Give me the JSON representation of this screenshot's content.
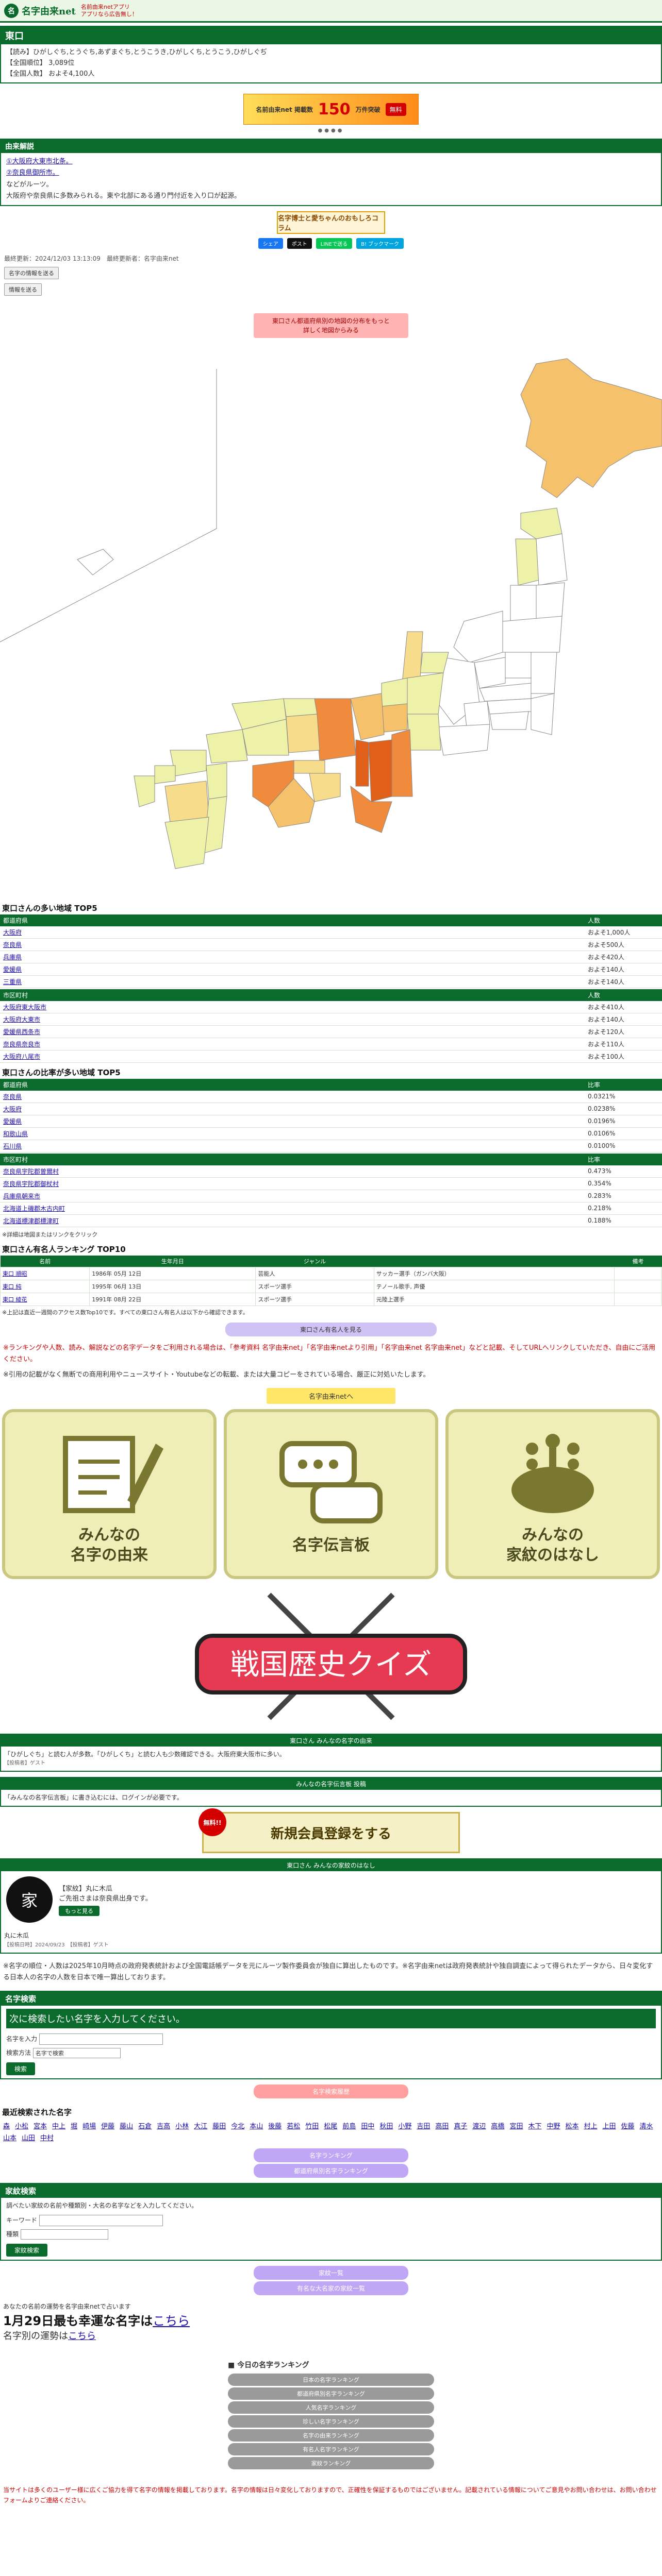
{
  "header": {
    "logo_mark": "名",
    "logo_text": "名字由来net",
    "note1": "名前由来netアプリ",
    "note2": "アプリなら広告無し！"
  },
  "title": {
    "name": "東口",
    "reading": "【読み】ひがしぐち,とうぐち,あずまぐち,とうこうき,ひがしくち,とうこう,ひがしぐぢ",
    "rank": "【全国順位】 3,089位",
    "population": "【全国人数】 およそ4,100人"
  },
  "ad": {
    "left": "名前由来net 掲載数",
    "num": "150",
    "tail": "万件突破",
    "btn": "無料"
  },
  "origin": {
    "heading": "由来解説",
    "lines": [
      "①大阪府大東市北条。",
      "②奈良県御所市。",
      "などがルーツ。",
      "大阪府や奈良県に多数みられる。東や北部にある通り門付近を入り口が起源。"
    ]
  },
  "banner": "名字博士と愛ちゃんのおもしろコラム",
  "share": {
    "fb": "シェア",
    "tw": "ポスト",
    "line": "LINEで送る",
    "hb": "B! ブックマーク"
  },
  "update": "最終更新：2024/12/03 13:13:09　最終更新者：名字由来net",
  "btn_edit": "名字の情報を送る",
  "btn_report": "情報を送る",
  "map_notice": [
    "東口さん都道府県別の地図の分布をもっと",
    "詳しく地図からみる"
  ],
  "top5_count": {
    "heading": "東口さんの多い地域 TOP5",
    "pref_header": [
      "都道府県",
      "人数"
    ],
    "prefs": [
      [
        "大阪府",
        "およそ1,000人"
      ],
      [
        "奈良県",
        "およそ500人"
      ],
      [
        "兵庫県",
        "およそ420人"
      ],
      [
        "愛媛県",
        "およそ140人"
      ],
      [
        "三重県",
        "およそ140人"
      ]
    ],
    "city_header": [
      "市区町村",
      "人数"
    ],
    "cities": [
      [
        "大阪府東大阪市",
        "およそ410人"
      ],
      [
        "大阪府大東市",
        "およそ140人"
      ],
      [
        "愛媛県西条市",
        "およそ120人"
      ],
      [
        "奈良県奈良市",
        "およそ110人"
      ],
      [
        "大阪府八尾市",
        "およそ100人"
      ]
    ]
  },
  "top5_ratio": {
    "heading": "東口さんの比率が多い地域 TOP5",
    "pref_header": [
      "都道府県",
      "比率"
    ],
    "prefs": [
      [
        "奈良県",
        "0.0321%"
      ],
      [
        "大阪府",
        "0.0238%"
      ],
      [
        "愛媛県",
        "0.0196%"
      ],
      [
        "和歌山県",
        "0.0106%"
      ],
      [
        "石川県",
        "0.0100%"
      ]
    ],
    "city_header": [
      "市区町村",
      "比率"
    ],
    "cities": [
      [
        "奈良県宇陀郡曽爾村",
        "0.473%"
      ],
      [
        "奈良県宇陀郡御杖村",
        "0.354%"
      ],
      [
        "兵庫県朝来市",
        "0.283%"
      ],
      [
        "北海道上磯郡木古内町",
        "0.218%"
      ],
      [
        "北海道標津郡標津町",
        "0.188%"
      ]
    ],
    "note": "※詳細は地図またはリンクをクリック"
  },
  "famous": {
    "heading": "東口さん有名人ランキング TOP10",
    "headers": [
      "名前",
      "生年月日",
      "ジャンル",
      "",
      "備考"
    ],
    "rows": [
      [
        "東口 順昭",
        "1986年 05月 12日",
        "芸能人",
        "サッカー選手（ガンバ大阪）",
        ""
      ],
      [
        "東口 純",
        "1995年 06月 13日",
        "スポーツ選手",
        "テノール歌手, 声優",
        ""
      ],
      [
        "東口 綾花",
        "1991年 08月 22日",
        "スポーツ選手",
        "元陸上選手",
        ""
      ]
    ],
    "note": "※上記は直近一週間のアクセス数Top10です。すべての東口さん有名人は以下から確認できます。"
  },
  "more_famous_btn": "東口さん有名人を見る",
  "info_para_red": "※ランキングや人数、読み、解説などの名字データをご利用される場合は、「参考資料 名字由来net」「名字由来netより引用」「名字由来net 名字由来net」などと記載、そしてURLへリンクしていただき、自由にご活用ください。",
  "info_para": "※引用の記載がなく無断での商用利用やニュースサイト・Youtubeなどの転載、または大量コピーをされている場合、厳正に対処いたします。",
  "yellow_btn": "名字由来netへ",
  "tiles": [
    {
      "label": "みんなの\n名字の由来"
    },
    {
      "label": "名字伝言板"
    },
    {
      "label": "みんなの\n家紋のはなし"
    }
  ],
  "quiz": "戦国歴史クイズ",
  "yurai_box": {
    "title": "東口さん みんなの名字の由来",
    "text": "「ひがしぐち」と読む人が多数。「ひがしくち」と読む人も少数確認できる。大阪府東大阪市に多い。",
    "meta": "【投稿者】ゲスト"
  },
  "board_box": {
    "title": "みんなの名字伝言板 投稿",
    "text": "「みんなの名字伝言板」に書き込むには、ログインが必要です。"
  },
  "register": {
    "free": "無料!!",
    "label": "新規会員登録をする"
  },
  "kamon_box": {
    "title": "東口さん みんなの家紋のはなし",
    "kamon_symbol": "家",
    "line1": "【家紋】丸に木瓜",
    "line2": "ご先祖さまは奈良県出身です。",
    "author": "丸に木瓜",
    "btn": "もっと見る",
    "meta": "【投稿日時】2024/09/23　【投稿者】ゲスト"
  },
  "about_para": "※名字の順位・人数は2025年10月時点の政府発表統計および全国電話帳データを元にルーツ製作委員会が独自に算出したものです。※名字由来netは政府発表統計や独自調査によって得られたデータから、日々変化する日本人の名字の人数を日本で唯一算出しております。",
  "search": {
    "heading": "名字検索",
    "alert": "次に検索したい名字を入力してください。",
    "label_name": "名字を入力",
    "label_method": "検索方法",
    "method_value": "名字で検索",
    "btn": "検索"
  },
  "pink_btn": "名字検索履歴",
  "recent": {
    "heading": "最近検索された名字",
    "names": [
      "森",
      "小松",
      "宮本",
      "中上",
      "堀",
      "崎場",
      "伊藤",
      "藤山",
      "石倉",
      "吉高",
      "小林",
      "大江",
      "藤田",
      "今北",
      "本山",
      "後藤",
      "若松",
      "竹田",
      "松尾",
      "前島",
      "田中",
      "秋田",
      "小野",
      "吉田",
      "高田",
      "真子",
      "渡辺",
      "高橋",
      "宮田",
      "木下",
      "中野",
      "松本",
      "村上",
      "上田",
      "佐藤",
      "清水",
      "山本",
      "山田",
      "中村"
    ]
  },
  "purple_btns": [
    "名字ランキング",
    "都道府県別名字ランキング"
  ],
  "kamon_search": {
    "heading": "家紋検索",
    "text": "調べたい家紋の名前や種類別・大名の名字などを入力してください。",
    "label_keyword": "キーワード",
    "label_type": "種類",
    "btn": "家紋検索"
  },
  "kamon_purple": [
    "家紋一覧",
    "有名な大名家の家紋一覧"
  ],
  "daily": {
    "small": "あなたの名前の運勢を名字由来netで占います",
    "big_prefix": "1月29日最も幸運な名字は",
    "big_link": "こちら",
    "med_prefix": "名字別の運勢は",
    "med_link": "こちら"
  },
  "ranking_list": {
    "title": "■ 今日の名字ランキング",
    "items": [
      "日本の名字ランキング",
      "都道府県別名字ランキング",
      "人気名字ランキング",
      "珍しい名字ランキング",
      "名字の由来ランキング",
      "有名人名字ランキング",
      "家紋ランキング"
    ]
  },
  "footer_note": "当サイトは多くのユーザー様に広くご協力を得て名字の情報を掲載しております。名字の情報は日々変化しておりますので、正確性を保証するものではございません。記載されている情報についてご意見やお問い合わせは、お問い合わせフォームよりご連絡ください。",
  "map_colors": {
    "sea": "#ffffff",
    "base": "#ffffff",
    "stroke": "#888888",
    "high": "#e0601a",
    "mid": "#f08a3c",
    "low": "#f5c26b",
    "lower": "#f7dc8c",
    "lowest": "#eef2a8"
  }
}
